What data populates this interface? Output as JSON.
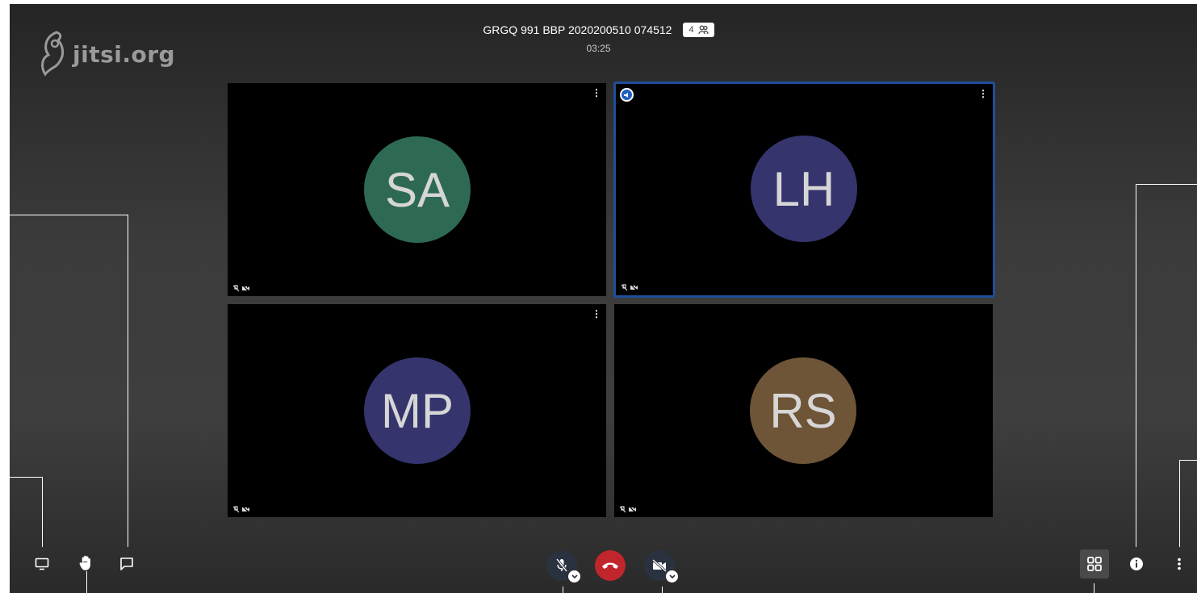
{
  "brand": {
    "logo_text": "jitsi.org"
  },
  "conference": {
    "title": "GRGQ 991 BBP 2020200510 074512",
    "participant_count": "4",
    "timer": "03:25"
  },
  "participants": [
    {
      "initials": "SA",
      "color": "#2e6a53",
      "dominant": false
    },
    {
      "initials": "LH",
      "color": "#35346d",
      "dominant": true
    },
    {
      "initials": "MP",
      "color": "#35346d",
      "dominant": false
    },
    {
      "initials": "RS",
      "color": "#6e5537",
      "dominant": false
    }
  ],
  "toolbar": {
    "left": [
      "screen-share-icon",
      "raise-hand-icon",
      "chat-icon"
    ],
    "center": [
      "microphone-muted-icon",
      "hangup-icon",
      "camera-muted-icon"
    ],
    "right": [
      "tile-view-icon",
      "info-icon",
      "more-options-icon"
    ]
  },
  "colors": {
    "active_border": "#1f4e9c",
    "hangup": "#c0262b",
    "dark_button": "#2a3240"
  }
}
